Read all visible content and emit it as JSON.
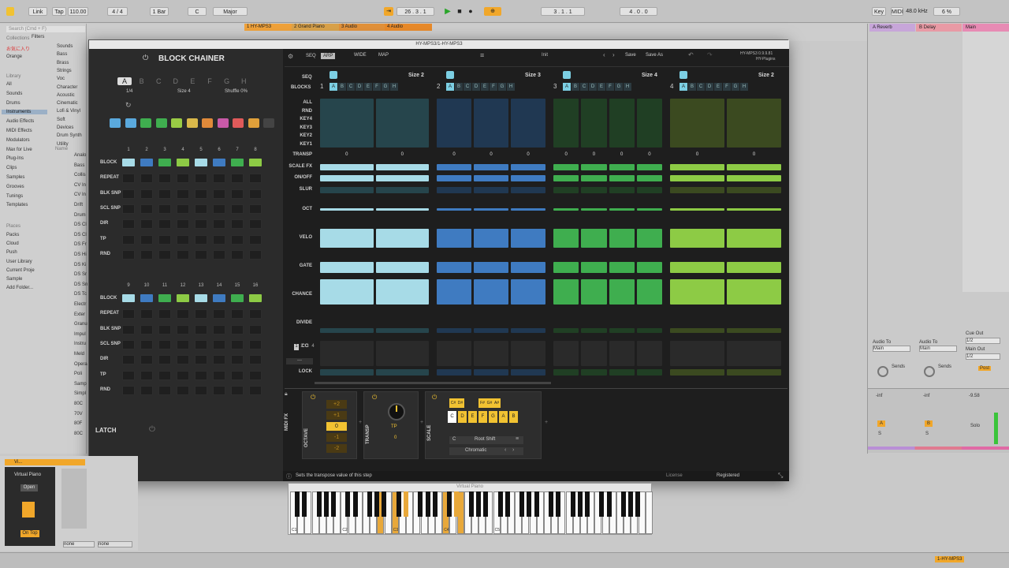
{
  "transport": {
    "link": "Link",
    "tap": "Tap",
    "tempo": "110.00",
    "sig": "4 / 4",
    "loop": "1 Bar",
    "key": "C",
    "scale": "Major",
    "pos": "26 . 3 . 1",
    "pos2": "3 . 1 . 1",
    "len": "4 . 0 . 0",
    "keybtn": "Key",
    "midibtn": "MIDI",
    "samplerate": "48.0 kHz",
    "cpu": "6 %"
  },
  "browser": {
    "search_placeholder": "Search (Cmd + F)",
    "collections": "Collections",
    "fav": "お気に入り",
    "orange": "Orange",
    "library": "Library",
    "items": [
      "All",
      "Sounds",
      "Drums",
      "Instruments",
      "Audio Effects",
      "MIDI Effects",
      "Modulators",
      "Max for Live",
      "Plug-Ins",
      "Clips",
      "Samples",
      "Grooves",
      "Tunings",
      "Templates"
    ],
    "places": "Places",
    "places_items": [
      "Packs",
      "Cloud",
      "Push",
      "User Library",
      "Current Proje",
      "Sample",
      "Add Folder..."
    ],
    "filters": "Filters",
    "filter_items": [
      "Sounds",
      "Bass",
      "Brass",
      "Strings",
      "Voc",
      "Character",
      "Acoustic",
      "Cinematic",
      "Lofi & Vinyl",
      "Soft",
      "Devices",
      "Drum Synth",
      "Utility"
    ],
    "name_header": "Name",
    "name_items": [
      "Analo",
      "Bass",
      "Collis",
      "CV In",
      "CV In",
      "Drift",
      "Drum",
      "DS Cl",
      "DS Cl",
      "DS Fr",
      "DS Hi",
      "DS Ki",
      "DS Sr",
      "DS Sn",
      "DS Tc",
      "Electr",
      "Exter",
      "Granu",
      "Impul",
      "Instru",
      "Meld",
      "Opera",
      "Poli",
      "Samp",
      "Simpl",
      "80C",
      "70V",
      "80F",
      "80C"
    ]
  },
  "tracks": [
    "1 HY-MPS3",
    "2 Grand Piano",
    "3 Audio",
    "4 Audio"
  ],
  "returns": [
    "A Reverb",
    "B Delay",
    "Main"
  ],
  "mixer": {
    "audio_to": "Audio To",
    "main": "Main",
    "cue_out": "Cue Out",
    "cue_val": "1/2",
    "main_out": "Main Out",
    "main_val": "1/2",
    "sends": "Sends",
    "post": "Post",
    "a": "A",
    "b": "B",
    "s": "S",
    "val1": "-inf",
    "val2": "-inf",
    "val3": "-9.58",
    "solo": "Solo"
  },
  "plugin": {
    "title": "HY-MPS3/1-HY-MPS3",
    "version": "HY-MPS3 0.9.9.81",
    "brand": "HY-Plugins",
    "seq": "SEQ",
    "arp": "ARP",
    "wide": "WIDE",
    "map": "MAP",
    "preset": "Init",
    "save": "Save",
    "save_as": "Save As",
    "status": "Sets the transpose value of this step",
    "license": "License",
    "registered": "Registered"
  },
  "chainer": {
    "title": "BLOCK CHAINER",
    "letters": [
      "A",
      "B",
      "C",
      "D",
      "E",
      "F",
      "G",
      "H"
    ],
    "rate": "1/4",
    "size": "Size 4",
    "shuffle": "Shuffle 0%",
    "nums1": [
      "1",
      "2",
      "3",
      "4",
      "5",
      "6",
      "7",
      "8"
    ],
    "nums2": [
      "9",
      "10",
      "11",
      "12",
      "13",
      "14",
      "15",
      "16"
    ],
    "rows": [
      "BLOCK",
      "REPEAT",
      "BLK SNP",
      "SCL SNP",
      "DIR",
      "TP",
      "RND"
    ],
    "latch": "LATCH",
    "block_colors": [
      "c1",
      "c2",
      "c3",
      "c4",
      "c1",
      "c2",
      "c3",
      "c4"
    ]
  },
  "seq": {
    "seq_label": "SEQ",
    "blocks_label": "BLOCKS",
    "sizes": [
      "Size 2",
      "Size 3",
      "Size 4",
      "Size 2"
    ],
    "block_nums": [
      "1",
      "2",
      "3",
      "4"
    ],
    "letters": [
      "A",
      "B",
      "C",
      "D",
      "E",
      "F",
      "G",
      "H"
    ],
    "rows": [
      "ALL",
      "RND",
      "KEY4",
      "KEY3",
      "KEY2",
      "KEY1",
      "TRANSP",
      "SCALE FX",
      "ON/OFF",
      "SLUR",
      "OCT",
      "VELO",
      "GATE",
      "CHANCE",
      "DIVIDE",
      "CC",
      "LOCK"
    ],
    "cc_tabs": [
      "1",
      "2",
      "3",
      "4"
    ],
    "transp_vals": [
      "0",
      "0",
      "0",
      "0",
      "0",
      "0",
      "0",
      "0",
      "0",
      "0",
      "0",
      "0",
      "0"
    ]
  },
  "midifx": {
    "label": "MIDI FX",
    "octave": "OCTAVE",
    "oct_vals": [
      "+2",
      "+1",
      "0",
      "-1",
      "-2"
    ],
    "transp": "TRANSP",
    "tp": "TP",
    "tp_val": "0",
    "scale": "SCALE",
    "sharps": [
      "C#",
      "D#",
      "F#",
      "G#",
      "A#"
    ],
    "naturals": [
      "C",
      "D",
      "E",
      "F",
      "G",
      "A",
      "B"
    ],
    "root": "C",
    "root_shift": "Root Shift",
    "mode": "Chromatic"
  },
  "piano": {
    "title": "Virtual Piano",
    "labels": [
      "C1",
      "C2",
      "C3",
      "C4",
      "C5"
    ]
  },
  "bottom": {
    "vp": "Virtual Piano",
    "open": "Open",
    "ontop": "On Top",
    "none1": "none",
    "none2": "none",
    "track_sel": "1-HY-MPS3"
  }
}
